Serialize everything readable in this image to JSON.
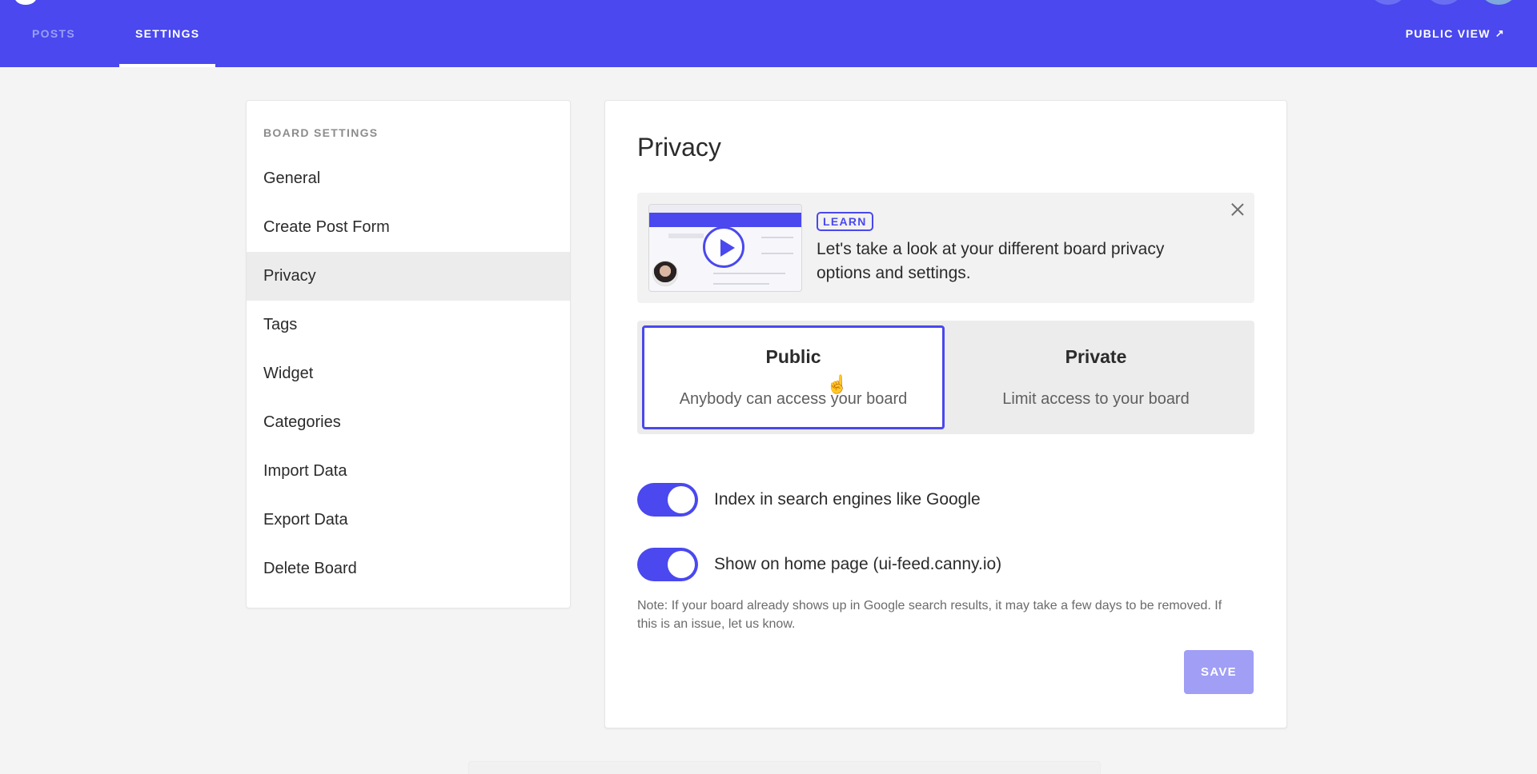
{
  "header": {
    "tabs": [
      {
        "label": "POSTS",
        "active": false
      },
      {
        "label": "SETTINGS",
        "active": true
      }
    ],
    "public_view_label": "PUBLIC VIEW",
    "public_view_icon": "↗",
    "accent_color": "#4a48ee"
  },
  "sidebar": {
    "heading": "BOARD SETTINGS",
    "items": [
      {
        "label": "General"
      },
      {
        "label": "Create Post Form"
      },
      {
        "label": "Privacy",
        "active": true
      },
      {
        "label": "Tags"
      },
      {
        "label": "Widget"
      },
      {
        "label": "Categories"
      },
      {
        "label": "Import Data"
      },
      {
        "label": "Export Data"
      },
      {
        "label": "Delete Board"
      }
    ]
  },
  "main": {
    "title": "Privacy",
    "learn": {
      "badge": "LEARN",
      "text": "Let's take a look at your different board privacy options and settings."
    },
    "privacy_options": [
      {
        "title": "Public",
        "description": "Anybody can access your board",
        "selected": true
      },
      {
        "title": "Private",
        "description": "Limit access to your board",
        "selected": false
      }
    ],
    "toggles": [
      {
        "label": "Index in search engines like Google",
        "on": true
      },
      {
        "label": "Show on home page (ui-feed.canny.io)",
        "on": true
      }
    ],
    "note": "Note: If your board already shows up in Google search results, it may take a few days to be removed. If this is an issue, let us know.",
    "save_label": "SAVE"
  }
}
